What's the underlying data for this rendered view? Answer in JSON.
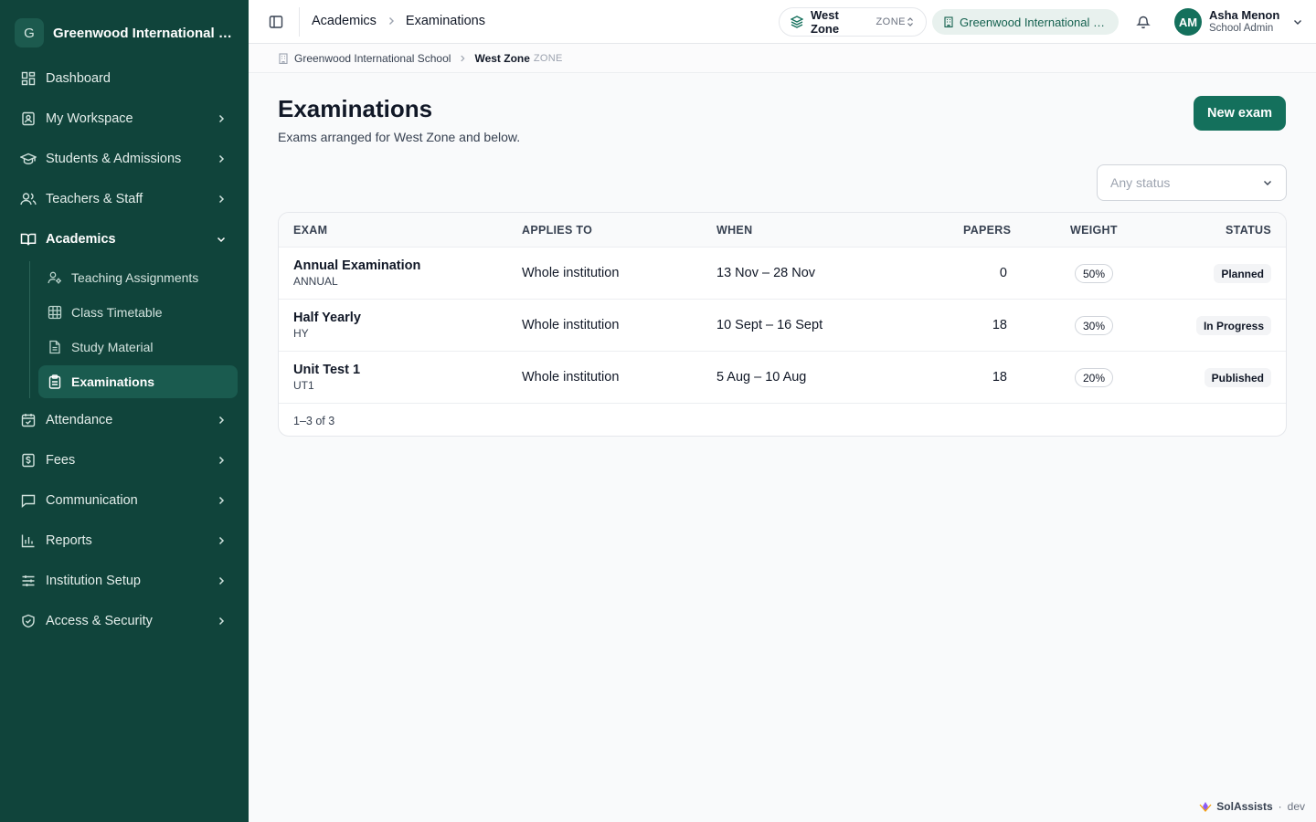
{
  "sidebar": {
    "org_initial": "G",
    "org_name": "Greenwood International School",
    "items": [
      {
        "label": "Dashboard",
        "icon": "dashboard-icon"
      },
      {
        "label": "My Workspace",
        "icon": "workspace-icon"
      },
      {
        "label": "Students & Admissions",
        "icon": "graduation-cap-icon"
      },
      {
        "label": "Teachers & Staff",
        "icon": "users-icon"
      },
      {
        "label": "Academics",
        "icon": "book-open-icon"
      },
      {
        "label": "Attendance",
        "icon": "calendar-check-icon"
      },
      {
        "label": "Fees",
        "icon": "dollar-icon"
      },
      {
        "label": "Communication",
        "icon": "message-icon"
      },
      {
        "label": "Reports",
        "icon": "bar-chart-icon"
      },
      {
        "label": "Institution Setup",
        "icon": "sliders-icon"
      },
      {
        "label": "Access & Security",
        "icon": "shield-icon"
      }
    ],
    "academics_sub": [
      {
        "label": "Teaching Assignments",
        "icon": "user-cog-icon"
      },
      {
        "label": "Class Timetable",
        "icon": "grid-icon"
      },
      {
        "label": "Study Material",
        "icon": "file-text-icon"
      },
      {
        "label": "Examinations",
        "icon": "clipboard-icon"
      }
    ]
  },
  "topbar": {
    "breadcrumb": [
      "Academics",
      "Examinations"
    ],
    "zone_name": "West Zone",
    "zone_tag": "ZONE",
    "school": "Greenwood International School",
    "user_initials": "AM",
    "user_name": "Asha Menon",
    "user_role": "School Admin"
  },
  "subbar": {
    "school": "Greenwood International School",
    "zone": "West Zone",
    "zone_tag": "ZONE"
  },
  "page": {
    "title": "Examinations",
    "subtitle": "Exams arranged for West Zone and below.",
    "new_button": "New exam",
    "status_filter_placeholder": "Any status"
  },
  "table": {
    "headers": {
      "exam": "EXAM",
      "applies": "APPLIES TO",
      "when": "WHEN",
      "papers": "PAPERS",
      "weight": "WEIGHT",
      "status": "STATUS"
    },
    "rows": [
      {
        "name": "Annual Examination",
        "code": "ANNUAL",
        "applies": "Whole institution",
        "when": "13 Nov – 28 Nov",
        "papers": "0",
        "weight": "50%",
        "status": "Planned"
      },
      {
        "name": "Half Yearly",
        "code": "HY",
        "applies": "Whole institution",
        "when": "10 Sept – 16 Sept",
        "papers": "18",
        "weight": "30%",
        "status": "In Progress"
      },
      {
        "name": "Unit Test 1",
        "code": "UT1",
        "applies": "Whole institution",
        "when": "5 Aug – 10 Aug",
        "papers": "18",
        "weight": "20%",
        "status": "Published"
      }
    ],
    "footer": "1–3 of 3"
  },
  "footer": {
    "brand": "SolAssists",
    "env": "dev"
  },
  "colors": {
    "sidebar": "#10443b",
    "accent": "#14705c"
  }
}
